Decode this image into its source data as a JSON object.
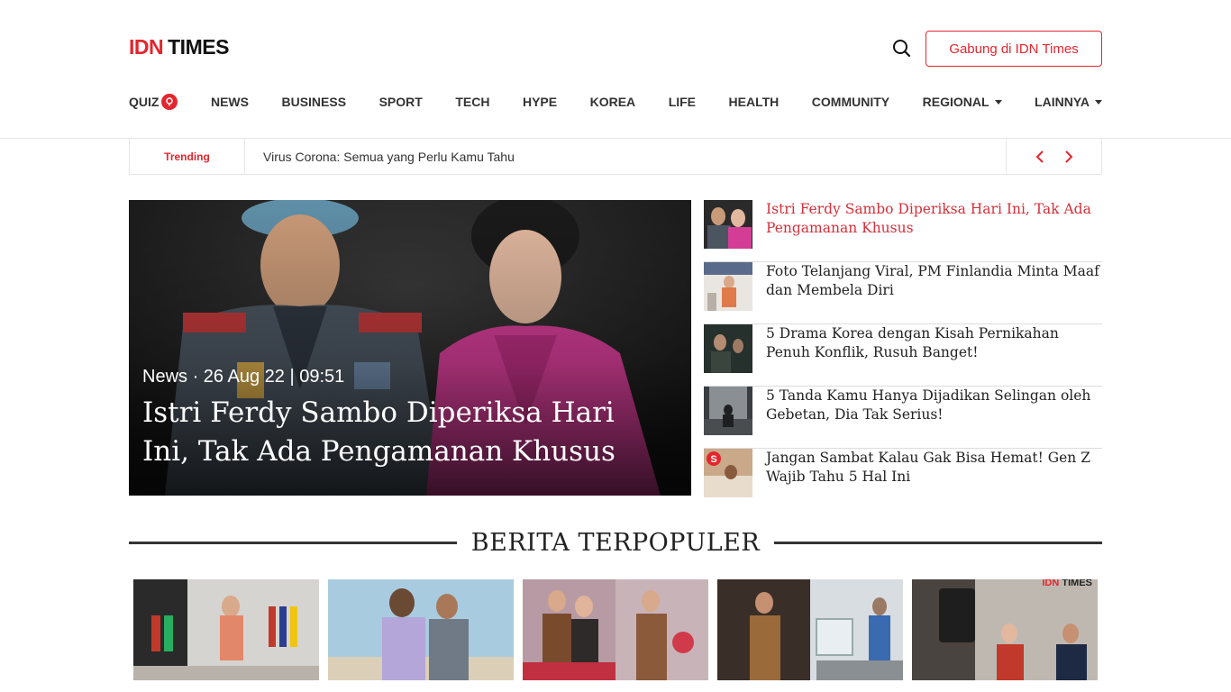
{
  "header": {
    "logo_idn": "IDN",
    "logo_times": "TIMES",
    "join_label": "Gabung di IDN Times",
    "search_icon": "search-icon"
  },
  "nav": {
    "items": [
      {
        "label": "QUIZ"
      },
      {
        "label": "NEWS"
      },
      {
        "label": "BUSINESS"
      },
      {
        "label": "SPORT"
      },
      {
        "label": "TECH"
      },
      {
        "label": "HYPE"
      },
      {
        "label": "KOREA"
      },
      {
        "label": "LIFE"
      },
      {
        "label": "HEALTH"
      },
      {
        "label": "COMMUNITY"
      },
      {
        "label": "REGIONAL"
      },
      {
        "label": "LAINNYA"
      }
    ]
  },
  "trending": {
    "label": "Trending",
    "text": "Virus Corona: Semua yang Perlu Kamu Tahu"
  },
  "hero": {
    "category": "News",
    "date": "· 26 Aug 22 | 09:51",
    "title": "Istri Ferdy Sambo Diperiksa Hari Ini, Tak Ada Pengamanan Khusus"
  },
  "side_list": [
    {
      "title": "Istri Ferdy Sambo Diperiksa Hari Ini, Tak Ada Pengamanan Khusus"
    },
    {
      "title": "Foto Telanjang Viral, PM Finlandia Minta Maaf dan Membela Diri"
    },
    {
      "title": "5 Drama Korea dengan Kisah Pernikahan Penuh Konflik, Rusuh Banget!"
    },
    {
      "title": "5 Tanda Kamu Hanya Dijadikan Selingan oleh Gebetan, Dia Tak Serius!"
    },
    {
      "title": "Jangan Sambat Kalau Gak Bisa Hemat! Gen Z Wajib Tahu 5 Hal Ini"
    }
  ],
  "popular": {
    "heading": "BERITA TERPOPULER",
    "card_watermark": "IDN TIMES"
  },
  "colors": {
    "brand_red": "#e3262e",
    "text_dark": "#222222",
    "active_link": "#d4303a"
  }
}
